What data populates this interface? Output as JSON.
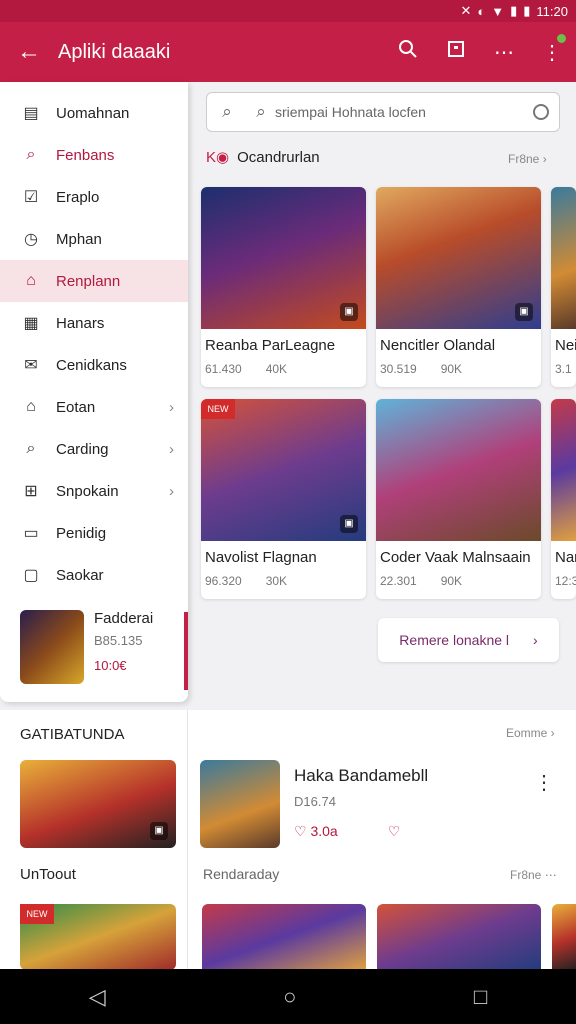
{
  "status": {
    "time": "11:20"
  },
  "appbar": {
    "title": "Apliki daaaki"
  },
  "drawer": {
    "items": [
      {
        "label": "Uomahnan",
        "icon": "store-icon"
      },
      {
        "label": "Fenbans",
        "icon": "search-icon"
      },
      {
        "label": "Eraplo",
        "icon": "checkbox-icon"
      },
      {
        "label": "Mphan",
        "icon": "clock-icon"
      },
      {
        "label": "Renplann",
        "icon": "home-icon"
      },
      {
        "label": "Hanars",
        "icon": "calendar-icon"
      },
      {
        "label": "Cenidkans",
        "icon": "mail-icon"
      },
      {
        "label": "Eotan",
        "icon": "home-icon"
      },
      {
        "label": "Carding",
        "icon": "search-icon"
      },
      {
        "label": "Snpokain",
        "icon": "bag-icon"
      },
      {
        "label": "Penidig",
        "icon": "card-icon"
      },
      {
        "label": "Saokar",
        "icon": "box-icon"
      }
    ],
    "card": {
      "title": "Fadderai",
      "sub": "B85.135",
      "price": "10:0€"
    }
  },
  "search": {
    "placeholder": "sriempai Hohnata locfen"
  },
  "section1": {
    "title": "Ocandrurlan",
    "see_more": "Fr8ne"
  },
  "cards": [
    {
      "name": "Reanba ParLeagne",
      "m1": "61.430",
      "m2": "40K"
    },
    {
      "name": "Nencitler Olandal",
      "m1": "30.519",
      "m2": "90K"
    },
    {
      "name": "Navolist Flagnan",
      "m1": "96.320",
      "m2": "30K"
    },
    {
      "name": "Coder Vaak Malnsaain",
      "m1": "22.301",
      "m2": "90K"
    }
  ],
  "partial_cards": [
    {
      "name": "Nei",
      "m1": "3.1"
    },
    {
      "name": "Nar",
      "m1": "12:3"
    }
  ],
  "more_button": {
    "label": "Remere lonakne l"
  },
  "section2": {
    "title": "GATIBATUNDA",
    "subtitle": "UnToout",
    "see_more": "Eomme"
  },
  "featured": {
    "title": "Haka Bandamebll",
    "sub": "D16.74",
    "likes": "3.0a",
    "heart": "♡"
  },
  "section3": {
    "title": "Rendaraday",
    "see_more": "Fr8ne"
  }
}
